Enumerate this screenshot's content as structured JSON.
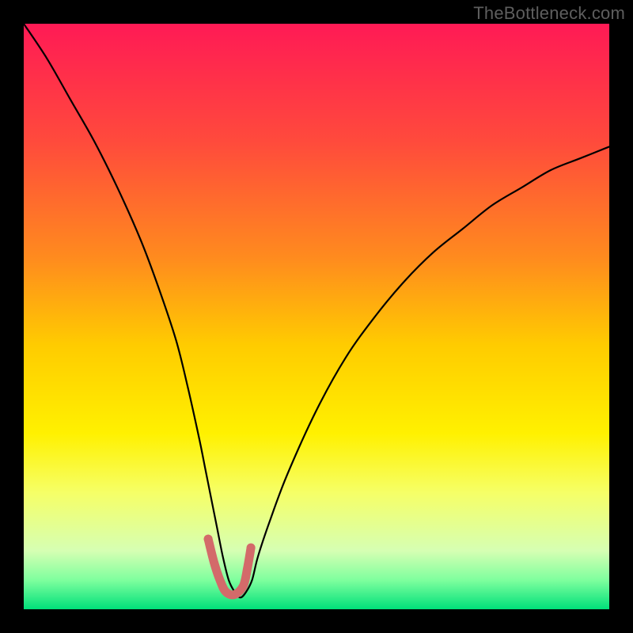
{
  "watermark": "TheBottleneck.com",
  "chart_data": {
    "type": "line",
    "title": "",
    "xlabel": "",
    "ylabel": "",
    "xlim": [
      0,
      100
    ],
    "ylim": [
      0,
      100
    ],
    "grid": false,
    "background_gradient": {
      "stops": [
        {
          "pos": 0.0,
          "color": "#ff1a55"
        },
        {
          "pos": 0.2,
          "color": "#ff4a3c"
        },
        {
          "pos": 0.4,
          "color": "#ff8b1e"
        },
        {
          "pos": 0.55,
          "color": "#ffcc00"
        },
        {
          "pos": 0.7,
          "color": "#fff100"
        },
        {
          "pos": 0.8,
          "color": "#f6ff66"
        },
        {
          "pos": 0.9,
          "color": "#d6ffb3"
        },
        {
          "pos": 0.95,
          "color": "#7fff9e"
        },
        {
          "pos": 1.0,
          "color": "#00e07a"
        }
      ]
    },
    "series": [
      {
        "name": "bottleneck-curve",
        "color": "#000000",
        "width": 2.2,
        "x": [
          0,
          4,
          8,
          12,
          16,
          20,
          23,
          26,
          28,
          30,
          31,
          32,
          33,
          34,
          35,
          36,
          37,
          38,
          39,
          40,
          42,
          45,
          50,
          55,
          60,
          65,
          70,
          75,
          80,
          85,
          90,
          95,
          100
        ],
        "y": [
          100,
          94,
          87,
          80,
          72,
          63,
          55,
          46,
          38,
          29,
          24,
          19,
          14,
          9,
          5,
          3,
          2,
          3,
          5,
          9,
          15,
          23,
          34,
          43,
          50,
          56,
          61,
          65,
          69,
          72,
          75,
          77,
          79
        ]
      },
      {
        "name": "optimal-marker",
        "color": "#d36a6a",
        "width": 11,
        "x": [
          31.5,
          32.5,
          33.5,
          34.5,
          36.0,
          37.5,
          38.2,
          38.8
        ],
        "y": [
          12.0,
          8.0,
          5.0,
          3.0,
          2.5,
          4.0,
          7.0,
          10.5
        ]
      }
    ]
  }
}
